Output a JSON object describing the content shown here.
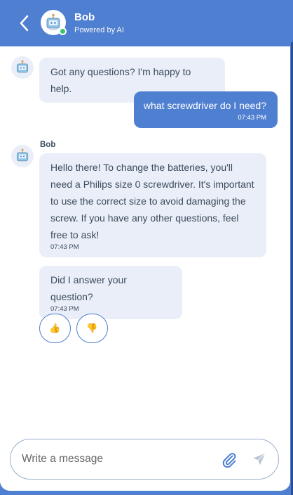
{
  "header": {
    "name": "Bob",
    "subtitle": "Powered by AI",
    "back_icon": "chevron-left-icon",
    "avatar_icon": "robot-avatar-icon",
    "status": "online"
  },
  "messages": [
    {
      "from": "bot",
      "text": "Got any questions? I'm happy to help.",
      "time": ""
    },
    {
      "from": "user",
      "text": "what screwdriver do I need?",
      "time": "07:43 PM"
    },
    {
      "from": "bot",
      "sender": "Bob",
      "text": "Hello there! To change the batteries, you'll need a Philips size 0 screwdriver. It's important to use the correct size to avoid damaging the screw. If you have any other questions, feel free to ask!",
      "time": "07:43 PM"
    },
    {
      "from": "bot",
      "text": "Did I answer your question?",
      "time": "07:43 PM"
    }
  ],
  "feedback": {
    "up": "👍",
    "down": "👎"
  },
  "composer": {
    "placeholder": "Write a message",
    "attach_icon": "paperclip-icon",
    "send_icon": "send-icon"
  },
  "colors": {
    "accent": "#4f7fd0",
    "bot_bubble": "#e9eef8",
    "text": "#3d4b5c"
  }
}
